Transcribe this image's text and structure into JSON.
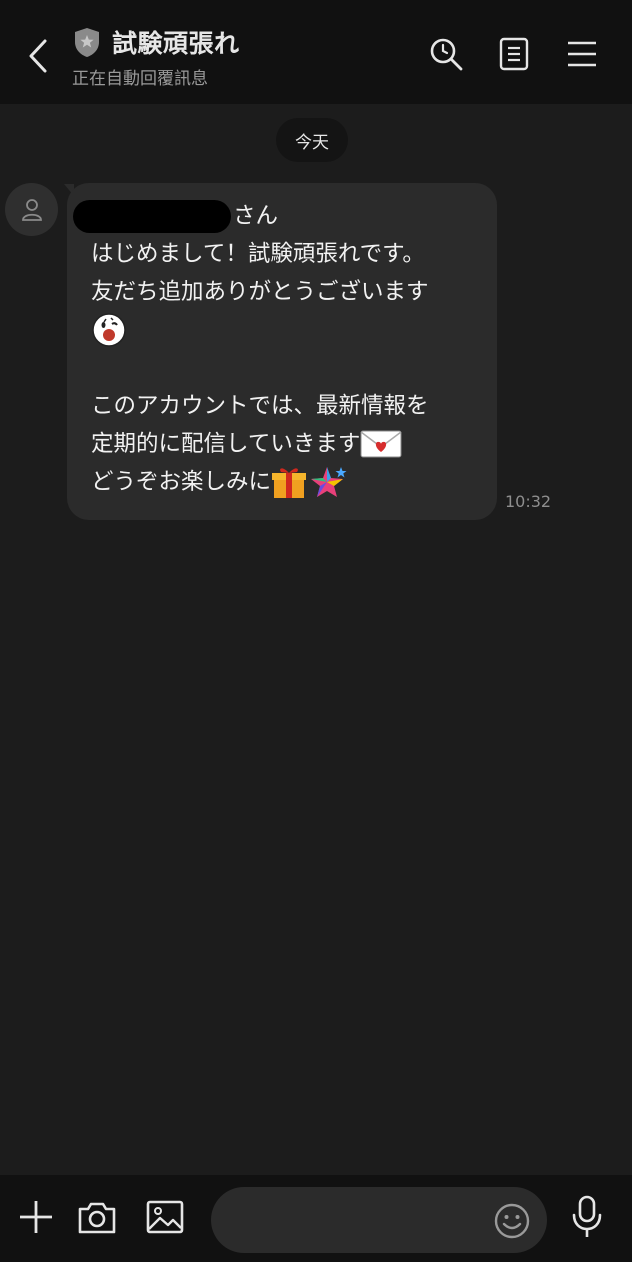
{
  "header": {
    "title": "試験頑張れ",
    "subtitle": "正在自動回覆訊息",
    "icons": [
      "back-icon",
      "shield-icon",
      "search-icon",
      "notes-icon",
      "menu-icon"
    ]
  },
  "chat": {
    "date_label": "今天",
    "message": {
      "line1_suffix": "さん",
      "line2": "はじめまして！試験頑張れです。",
      "line3": "友だち追加ありがとうございます",
      "line5": "このアカウントでは、最新情報を",
      "line6": "定期的に配信していきます",
      "line7": "どうぞお楽しみに",
      "emoji_icons": [
        "face-emoji-icon",
        "love-letter-icon",
        "gift-icon",
        "sparkle-star-icon"
      ],
      "time": "10:32"
    }
  },
  "footer": {
    "input_placeholder": "",
    "icons": [
      "plus-icon",
      "camera-icon",
      "image-icon",
      "smiley-icon",
      "microphone-icon"
    ]
  },
  "colors": {
    "header_bg": "#111111",
    "chat_bg": "#1c1c1c",
    "bubble_bg": "#2b2b2b"
  }
}
